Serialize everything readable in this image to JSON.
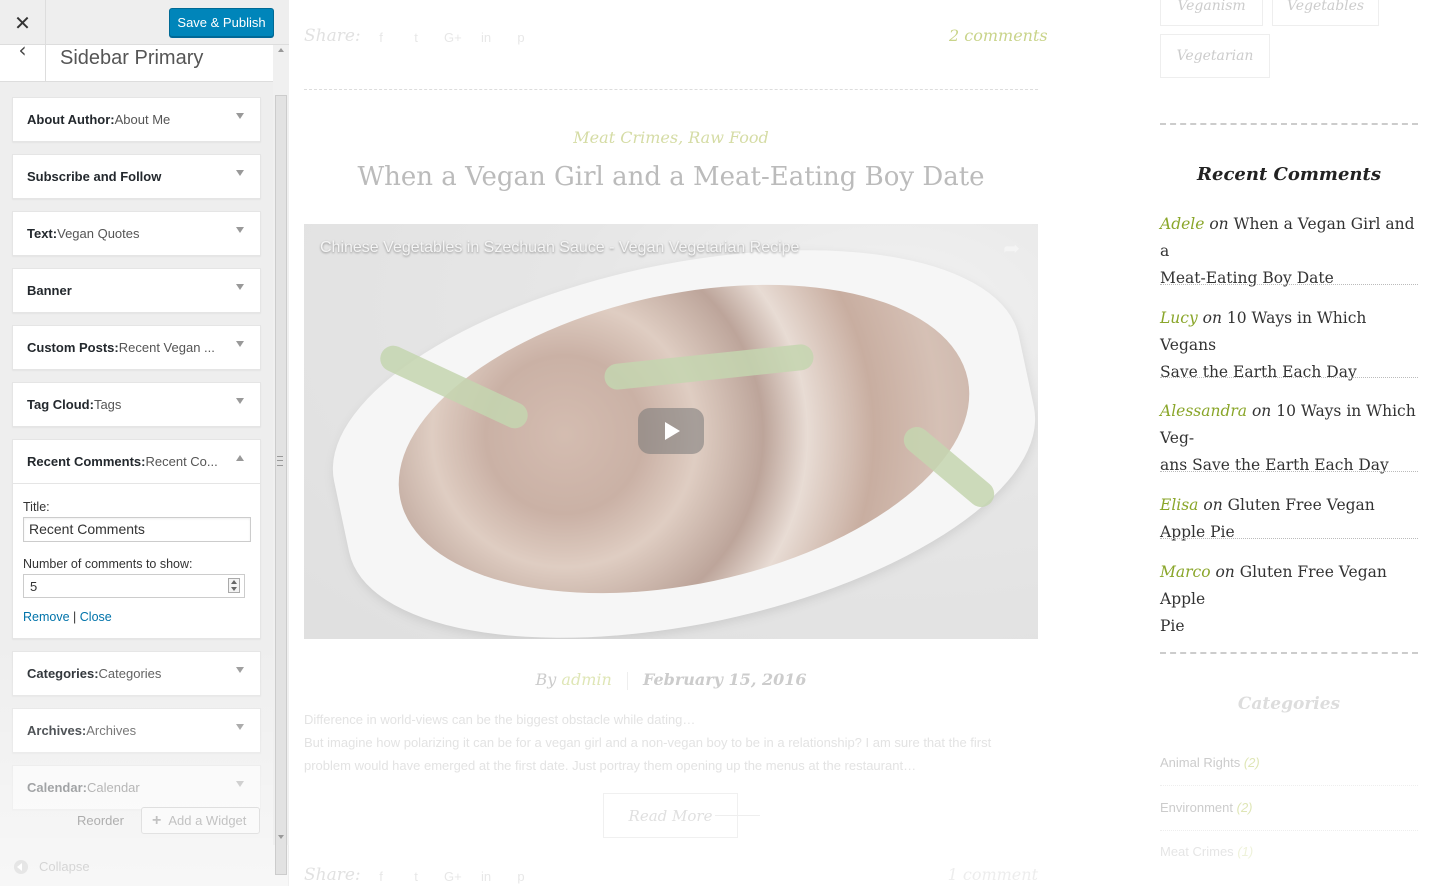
{
  "customizer": {
    "close_glyph": "✕",
    "save_label": "Save & Publish",
    "back_glyph": "‹",
    "section_title": "Sidebar Primary",
    "widgets": [
      {
        "name": "About Author",
        "sep": ": ",
        "title": "About Me"
      },
      {
        "name": "Subscribe and Follow",
        "sep": "",
        "title": ""
      },
      {
        "name": "Text",
        "sep": ": ",
        "title": "Vegan Quotes"
      },
      {
        "name": "Banner",
        "sep": "",
        "title": ""
      },
      {
        "name": "Custom Posts",
        "sep": ": ",
        "title": "Recent Vegan ..."
      },
      {
        "name": "Tag Cloud",
        "sep": ": ",
        "title": "Tags"
      },
      {
        "name": "Recent Comments",
        "sep": ": ",
        "title": "Recent Co..."
      },
      {
        "name": "Categories",
        "sep": ": ",
        "title": "Categories"
      },
      {
        "name": "Archives",
        "sep": ": ",
        "title": "Archives"
      },
      {
        "name": "Calendar",
        "sep": ": ",
        "title": "Calendar"
      }
    ],
    "recent_comments_form": {
      "title_label": "Title:",
      "title_value": "Recent Comments",
      "count_label": "Number of comments to show:",
      "count_value": "5",
      "remove_label": "Remove",
      "divider": "|",
      "close_label": "Close"
    },
    "reorder_label": "Reorder",
    "add_widget_label": "Add a Widget",
    "add_widget_plus": "+",
    "collapse_label": "Collapse"
  },
  "preview": {
    "share_label": "Share:",
    "share_icons": [
      "f",
      "t",
      "G+",
      "in",
      "p"
    ],
    "comments_count": "2 comments",
    "post_categories": "Meat Crimes, Raw Food",
    "post_title": "When a Vegan Girl and a Meat-Eating Boy Date",
    "video_title": "Chinese Vegetables in Szechuan Sauce - Vegan Vegetarian Recipe",
    "video_share_glyph": "➦",
    "byline_by": "By ",
    "byline_author": "admin",
    "byline_date": "February 15, 2016",
    "excerpt_lines": [
      "Difference in world-views can be the biggest obstacle while dating…",
      "But imagine how polarizing it can be for a vegan girl and a non-vegan boy to be in a relationship? I am sure that the first",
      "problem would have emerged at the first date. Just portray them opening up the menus at the restaurant…"
    ],
    "read_more": "Read More",
    "bottom_comments": "1 comment",
    "tags": [
      "Veganism",
      "Vegetables",
      "Vegetarian"
    ],
    "recent_comments_heading": "Recent Comments",
    "recent_comments": [
      {
        "author": "Adele",
        "on": " on ",
        "line1": "When a Vegan Girl and a",
        "line2": "Meat-Eating Boy Date"
      },
      {
        "author": "Lucy",
        "on": " on ",
        "line1": "10 Ways in Which Vegans",
        "line2": "Save the Earth Each Day"
      },
      {
        "author": "Alessandra",
        "on": " on ",
        "line1": "10 Ways in Which Veg-",
        "line2": "ans Save the Earth Each Day"
      },
      {
        "author": "Elisa",
        "on": " on ",
        "line1": "Gluten Free Vegan Apple Pie",
        "line2": ""
      },
      {
        "author": "Marco",
        "on": " on ",
        "line1": "Gluten Free Vegan Apple",
        "line2": "Pie"
      }
    ],
    "categories_heading": "Categories",
    "categories": [
      {
        "name": "Animal Rights",
        "count": "(2)"
      },
      {
        "name": "Environment",
        "count": "(2)"
      },
      {
        "name": "Meat Crimes",
        "count": "(1)"
      }
    ]
  },
  "colors": {
    "publish_blue": "#0085ba",
    "link_blue": "#0073aa",
    "author_green": "#8aa62a"
  }
}
